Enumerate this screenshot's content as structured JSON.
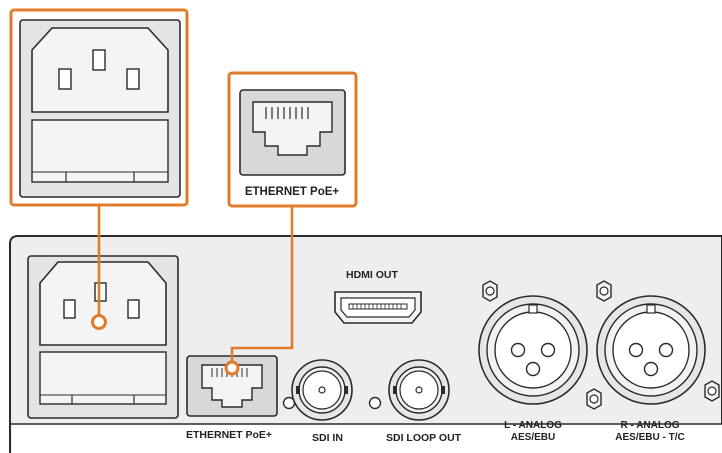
{
  "callouts": {
    "power_detail": {
      "label": ""
    },
    "ethernet_detail": {
      "label": "ETHERNET PoE+"
    }
  },
  "panel": {
    "hdmi_out_label": "HDMI OUT",
    "ethernet_label": "ETHERNET PoE+",
    "sdi_in_label": "SDI IN",
    "sdi_loop_out_label": "SDI LOOP OUT",
    "xlr_left_line1": "L - ANALOG",
    "xlr_left_line2": "AES/EBU",
    "xlr_right_line1": "R - ANALOG",
    "xlr_right_line2": "AES/EBU - T/C"
  },
  "colors": {
    "accent": "#e07b2a",
    "panel_fill": "#ececec",
    "stroke": "#2b2b2b"
  }
}
